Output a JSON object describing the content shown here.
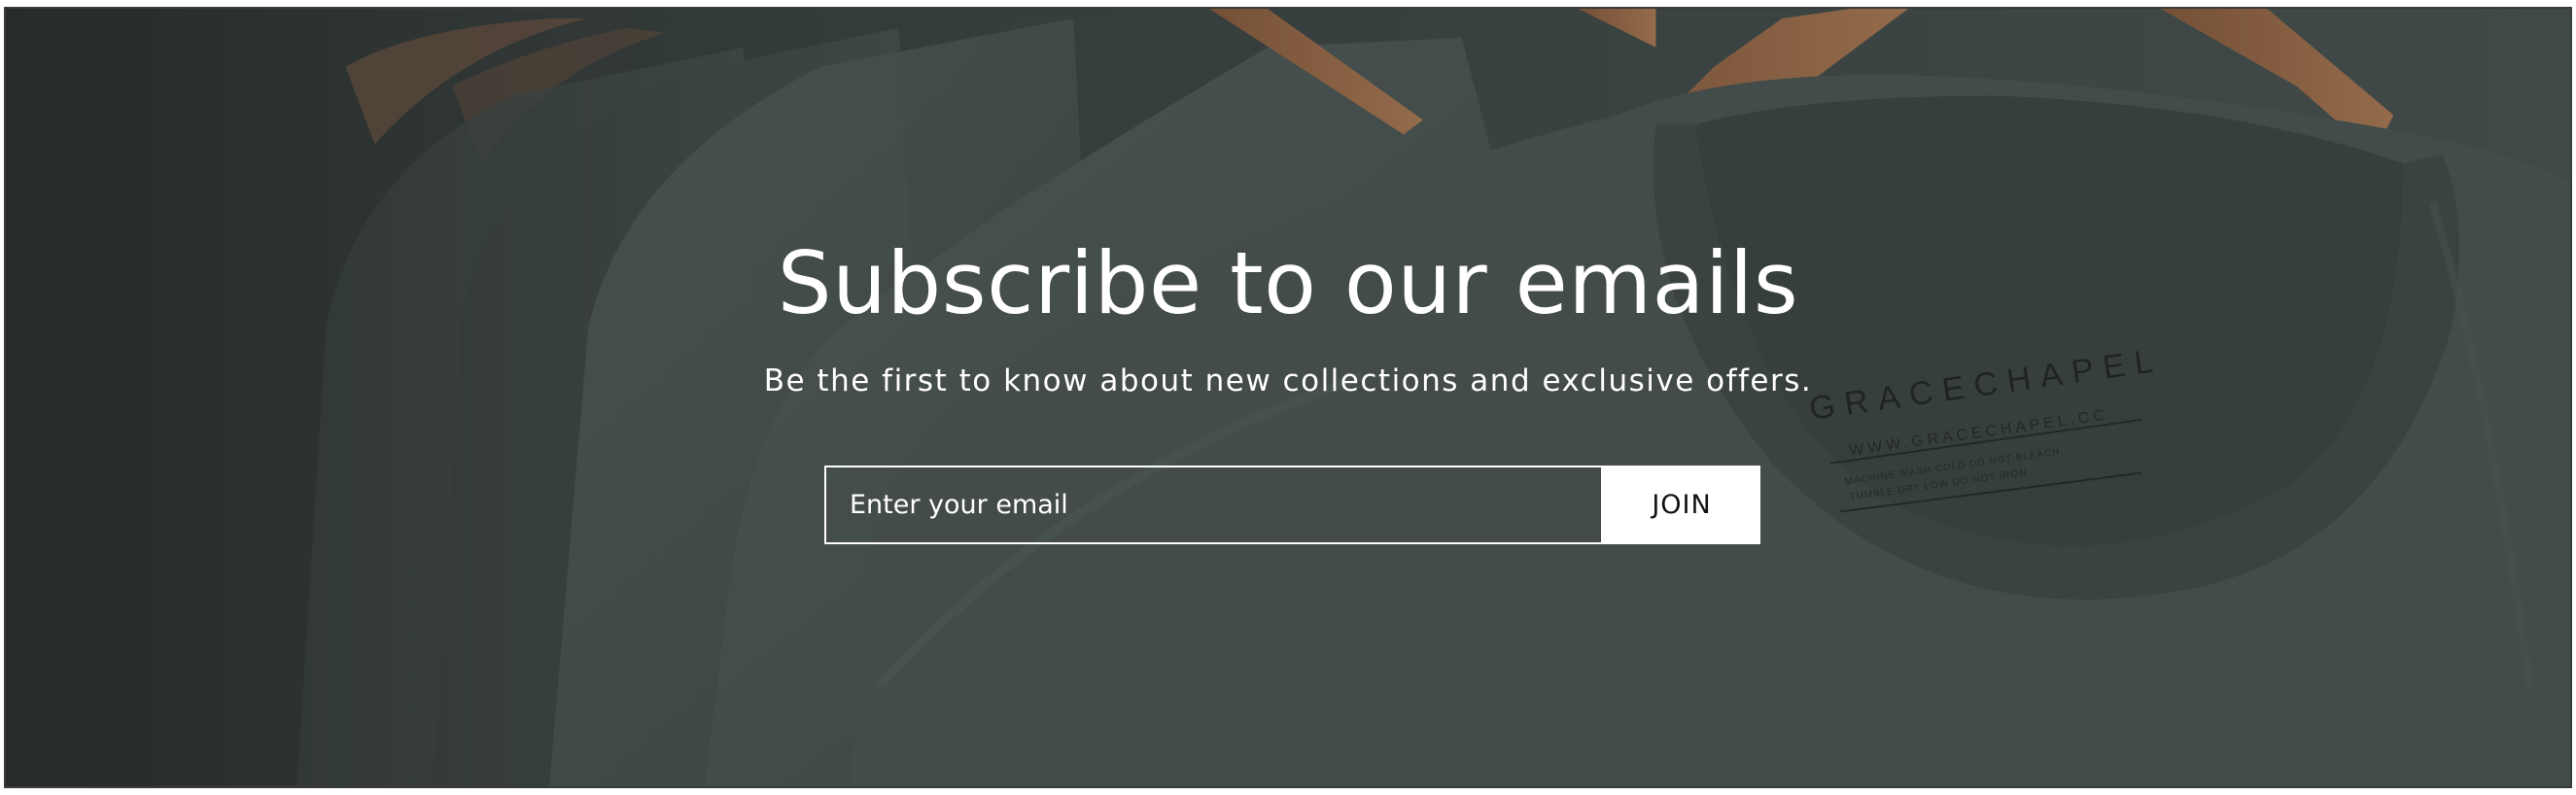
{
  "newsletter": {
    "heading": "Subscribe to our emails",
    "subheading": "Be the first to know about new collections and exclusive offers.",
    "email_placeholder": "Enter your email",
    "join_label": "JOIN"
  },
  "background": {
    "label_brand": "GRACECHAPEL",
    "label_url": "WWW.GRACECHAPEL.CC",
    "label_care_1": "MACHINE WASH COLD DO NOT BLEACH",
    "label_care_2": "TUMBLE DRY LOW DO NOT IRON",
    "colors": {
      "shirt": "#4a5553",
      "hanger": "#9a6a48",
      "wall": "#2e3433"
    }
  }
}
